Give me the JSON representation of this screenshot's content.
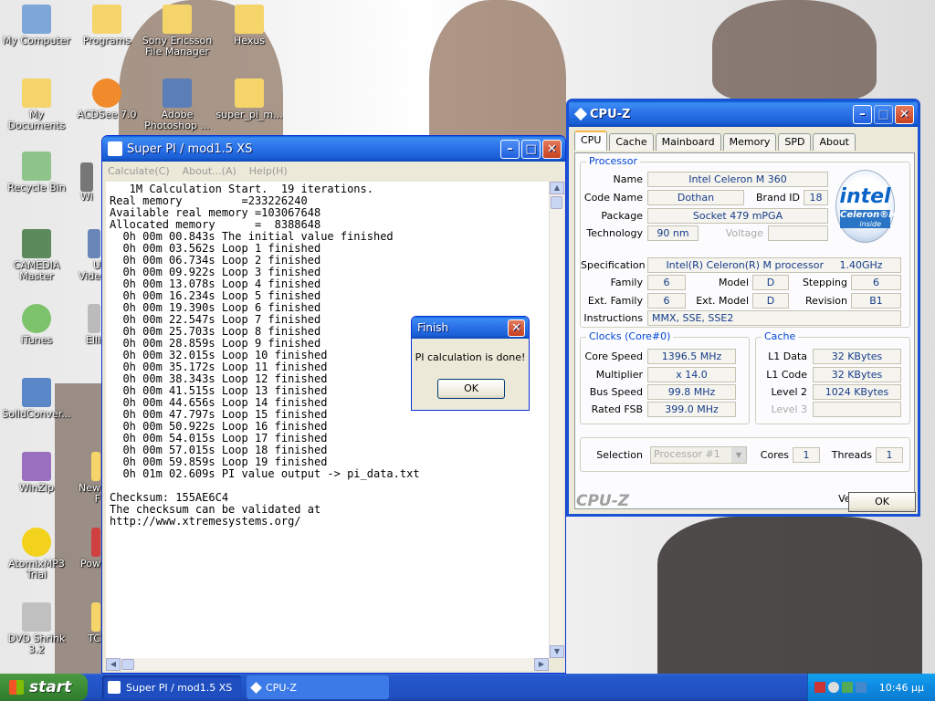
{
  "desktop": {
    "icons": [
      {
        "label": "My Computer"
      },
      {
        "label": "Programs"
      },
      {
        "label": "Sony Ericsson File Manager"
      },
      {
        "label": "Hexus"
      },
      {
        "label": "My Documents"
      },
      {
        "label": "ACDSee 7.0"
      },
      {
        "label": "Adobe Photoshop ..."
      },
      {
        "label": "super_pi_m..."
      },
      {
        "label": "Recycle Bin"
      },
      {
        "label": "CAMEDIA Master"
      },
      {
        "label": "iTunes"
      },
      {
        "label": "SolidConver..."
      },
      {
        "label": "WinZip"
      },
      {
        "label": "AtomixMP3 Trial"
      },
      {
        "label": "DVD Shrink 3.2"
      }
    ],
    "partial_icons": [
      {
        "label": "Wi"
      },
      {
        "label": "U Vide"
      },
      {
        "label": "Elli"
      },
      {
        "label": "New F"
      },
      {
        "label": "Pow"
      },
      {
        "label": "TC"
      }
    ]
  },
  "superpi": {
    "title": "Super PI / mod1.5 XS",
    "menu": [
      "Calculate(C)",
      "About...(A)",
      "Help(H)"
    ],
    "output": "   1M Calculation Start.  19 iterations.\nReal memory         =233226240\nAvailable real memory =103067648\nAllocated memory      =  8388648\n  0h 00m 00.843s The initial value finished\n  0h 00m 03.562s Loop 1 finished\n  0h 00m 06.734s Loop 2 finished\n  0h 00m 09.922s Loop 3 finished\n  0h 00m 13.078s Loop 4 finished\n  0h 00m 16.234s Loop 5 finished\n  0h 00m 19.390s Loop 6 finished\n  0h 00m 22.547s Loop 7 finished\n  0h 00m 25.703s Loop 8 finished\n  0h 00m 28.859s Loop 9 finished\n  0h 00m 32.015s Loop 10 finished\n  0h 00m 35.172s Loop 11 finished\n  0h 00m 38.343s Loop 12 finished\n  0h 00m 41.515s Loop 13 finished\n  0h 00m 44.656s Loop 14 finished\n  0h 00m 47.797s Loop 15 finished\n  0h 00m 50.922s Loop 16 finished\n  0h 00m 54.015s Loop 17 finished\n  0h 00m 57.015s Loop 18 finished\n  0h 00m 59.859s Loop 19 finished\n  0h 01m 02.609s PI value output -> pi_data.txt\n\nChecksum: 155AE6C4\nThe checksum can be validated at\nhttp://www.xtremesystems.org/"
  },
  "finish_dialog": {
    "title": "Finish",
    "message": "PI calculation is done!",
    "ok": "OK"
  },
  "cpuz": {
    "title": "CPU-Z",
    "tabs": [
      "CPU",
      "Cache",
      "Mainboard",
      "Memory",
      "SPD",
      "About"
    ],
    "processor": {
      "group": "Processor",
      "name_label": "Name",
      "name": "Intel Celeron M 360",
      "codename_label": "Code Name",
      "codename": "Dothan",
      "brandid_label": "Brand ID",
      "brandid": "18",
      "package_label": "Package",
      "package": "Socket 479 mPGA",
      "technology_label": "Technology",
      "technology": "90 nm",
      "voltage_label": "Voltage",
      "voltage": "",
      "spec_label": "Specification",
      "spec": "Intel(R) Celeron(R) M processor",
      "spec_freq": "1.40GHz",
      "family_label": "Family",
      "family": "6",
      "model_label": "Model",
      "model": "D",
      "stepping_label": "Stepping",
      "stepping": "6",
      "extfamily_label": "Ext. Family",
      "extfamily": "6",
      "extmodel_label": "Ext. Model",
      "extmodel": "D",
      "revision_label": "Revision",
      "revision": "B1",
      "instructions_label": "Instructions",
      "instructions": "MMX, SSE, SSE2"
    },
    "logo": {
      "brand": "intel",
      "line1": "Celeron®M",
      "line2": "inside"
    },
    "clocks": {
      "group": "Clocks (Core#0)",
      "core_speed_label": "Core Speed",
      "core_speed": "1396.5 MHz",
      "multiplier_label": "Multiplier",
      "multiplier": "x 14.0",
      "bus_speed_label": "Bus Speed",
      "bus_speed": "99.8 MHz",
      "rated_fsb_label": "Rated FSB",
      "rated_fsb": "399.0 MHz"
    },
    "cache": {
      "group": "Cache",
      "l1data_label": "L1 Data",
      "l1data": "32 KBytes",
      "l1code_label": "L1 Code",
      "l1code": "32 KBytes",
      "level2_label": "Level 2",
      "level2": "1024 KBytes",
      "level3_label": "Level 3",
      "level3": ""
    },
    "selection_label": "Selection",
    "selection": "Processor #1",
    "cores_label": "Cores",
    "cores": "1",
    "threads_label": "Threads",
    "threads": "1",
    "version": "Version 1.40.5",
    "footer_brand": "CPU-Z",
    "ok": "OK"
  },
  "taskbar": {
    "start": "start",
    "items": [
      {
        "label": "Super PI / mod1.5 XS"
      },
      {
        "label": "CPU-Z"
      }
    ],
    "clock": "10:46 μμ"
  },
  "colors": {
    "accent": "#0a5ed8",
    "start_green": "#3c8c36",
    "cpuz_blue": "#163c8a"
  }
}
